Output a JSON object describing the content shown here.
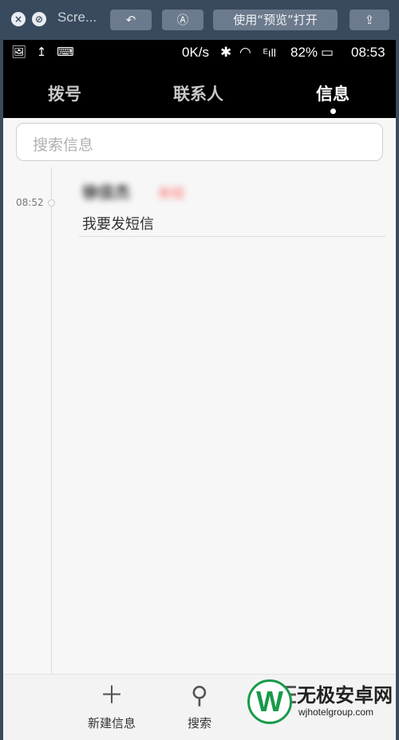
{
  "quicklook": {
    "title": "Scre...",
    "open_with_label": "使用“预览”打开",
    "close_glyph": "×",
    "stop_glyph": "⊘",
    "rotate_glyph": "↶",
    "markup_glyph": "Ⓐ",
    "share_glyph": "⇪"
  },
  "status": {
    "left_icons": "🖼 ↥ ⌨",
    "speed": "0K/s",
    "bt": "✱",
    "wifi": "◠",
    "signal": "ᴱıll",
    "battery": "82%",
    "battery_glyph": "▭",
    "time": "08:53"
  },
  "tabs": [
    {
      "label": "拨号"
    },
    {
      "label": "联系人"
    },
    {
      "label": "信息"
    }
  ],
  "search": {
    "placeholder": "搜索信息"
  },
  "messages": [
    {
      "time": "08:52",
      "sender": "徐佳杰",
      "tag": "新短",
      "preview": "我要发短信"
    }
  ],
  "bottom": [
    {
      "icon": "＋",
      "label": "新建信息"
    },
    {
      "icon": "⚲",
      "label": "搜索"
    },
    {
      "icon": "☰",
      "label": ""
    }
  ],
  "watermark": {
    "logo": "W",
    "title": "无极安卓网",
    "url": "wjhotelgroup.com"
  }
}
